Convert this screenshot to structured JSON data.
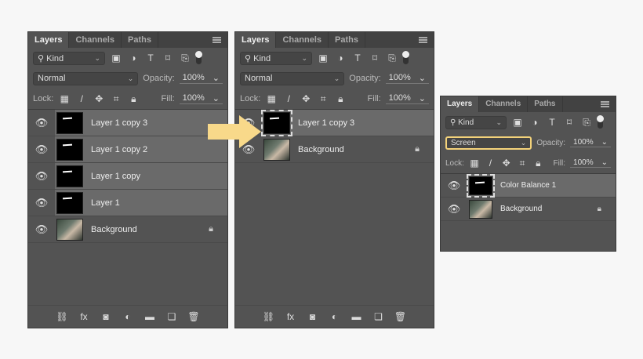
{
  "panels": [
    {
      "tabs": [
        "Layers",
        "Channels",
        "Paths"
      ],
      "filter": "Kind",
      "blend": "Normal",
      "opacity_label": "Opacity:",
      "opacity": "100%",
      "lock_label": "Lock:",
      "fill_label": "Fill:",
      "fill": "100%",
      "layers": [
        {
          "name": "Layer 1 copy 3",
          "thumb": "mask",
          "selected": true
        },
        {
          "name": "Layer 1 copy 2",
          "thumb": "mask",
          "selected": true
        },
        {
          "name": "Layer 1 copy",
          "thumb": "mask",
          "selected": true
        },
        {
          "name": "Layer 1",
          "thumb": "mask",
          "selected": true
        },
        {
          "name": "Background",
          "thumb": "photo",
          "locked": true
        }
      ],
      "footer": [
        "link-icon",
        "fx-icon",
        "mask-icon",
        "adjustment-icon",
        "folder-icon",
        "new-layer-icon",
        "trash-icon"
      ]
    },
    {
      "tabs": [
        "Layers",
        "Channels",
        "Paths"
      ],
      "filter": "Kind",
      "blend": "Normal",
      "opacity_label": "Opacity:",
      "opacity": "100%",
      "lock_label": "Lock:",
      "fill_label": "Fill:",
      "fill": "100%",
      "layers": [
        {
          "name": "Layer 1 copy 3",
          "thumb": "mask",
          "selected": true,
          "framed": true
        },
        {
          "name": "Background",
          "thumb": "photo",
          "locked": true
        }
      ],
      "footer": [
        "link-icon",
        "fx-icon",
        "mask-icon",
        "adjustment-icon",
        "folder-icon",
        "new-layer-icon",
        "trash-icon"
      ]
    },
    {
      "tabs": [
        "Layers",
        "Channels",
        "Paths"
      ],
      "filter": "Kind",
      "blend": "Screen",
      "blend_highlight": true,
      "opacity_label": "Opacity:",
      "opacity": "100%",
      "lock_label": "Lock:",
      "fill_label": "Fill:",
      "fill": "100%",
      "layers": [
        {
          "name": "Color Balance 1",
          "thumb": "mask",
          "selected": true,
          "framed": true
        },
        {
          "name": "Background",
          "thumb": "photo",
          "locked": true
        }
      ]
    }
  ],
  "colors": {
    "panel": "#535353",
    "selected": "#6a6a6a",
    "arrow": "#f8d98a",
    "highlight": "#f3d27a"
  }
}
